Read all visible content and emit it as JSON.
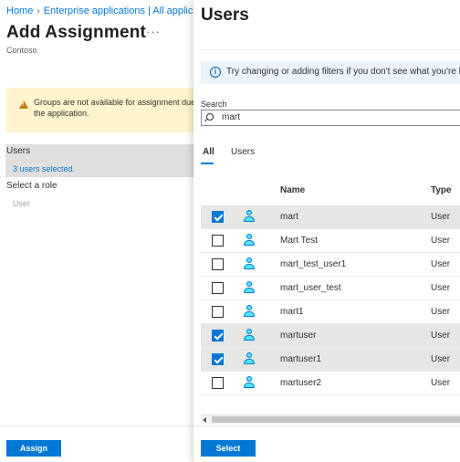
{
  "breadcrumb": {
    "home": "Home",
    "path": "Enterprise applications | All applications"
  },
  "page": {
    "title": "Add Assignment",
    "more": "···",
    "subtitle": "Contoso"
  },
  "warning": {
    "line1": "Groups are not available for assignment due to your Active Directory plan level. You can assign individual users to",
    "line2": "the application."
  },
  "assignment": {
    "users_label": "Users",
    "users_value": "3 users selected.",
    "role_label": "Select a role",
    "role_value": "User"
  },
  "footer_left": {
    "assign_label": "Assign"
  },
  "users_panel": {
    "title": "Users",
    "info": "Try changing or adding filters if you don't see what you're looking for.",
    "search_label": "Search",
    "search_value": "mart",
    "tabs": [
      {
        "label": "All",
        "active": true
      },
      {
        "label": "Users",
        "active": false
      }
    ],
    "columns": {
      "name": "Name",
      "type": "Type"
    },
    "rows": [
      {
        "name": "mart",
        "type": "User",
        "checked": true
      },
      {
        "name": "Mart Test",
        "type": "User",
        "checked": false
      },
      {
        "name": "mart_test_user1",
        "type": "User",
        "checked": false
      },
      {
        "name": "mart_user_test",
        "type": "User",
        "checked": false
      },
      {
        "name": "mart1",
        "type": "User",
        "checked": false
      },
      {
        "name": "martuser",
        "type": "User",
        "checked": true
      },
      {
        "name": "martuser1",
        "type": "User",
        "checked": true
      },
      {
        "name": "martuser2",
        "type": "User",
        "checked": false
      }
    ],
    "select_label": "Select"
  },
  "colors": {
    "accent": "#0078d4",
    "warning_bg": "#fff4ce",
    "info_bg": "#ebf3fc",
    "selected_row": "#e8e6e4"
  },
  "icons": {
    "row_icon": "user-icon",
    "info": "info-icon",
    "warning": "warning-icon",
    "search": "search-icon"
  }
}
